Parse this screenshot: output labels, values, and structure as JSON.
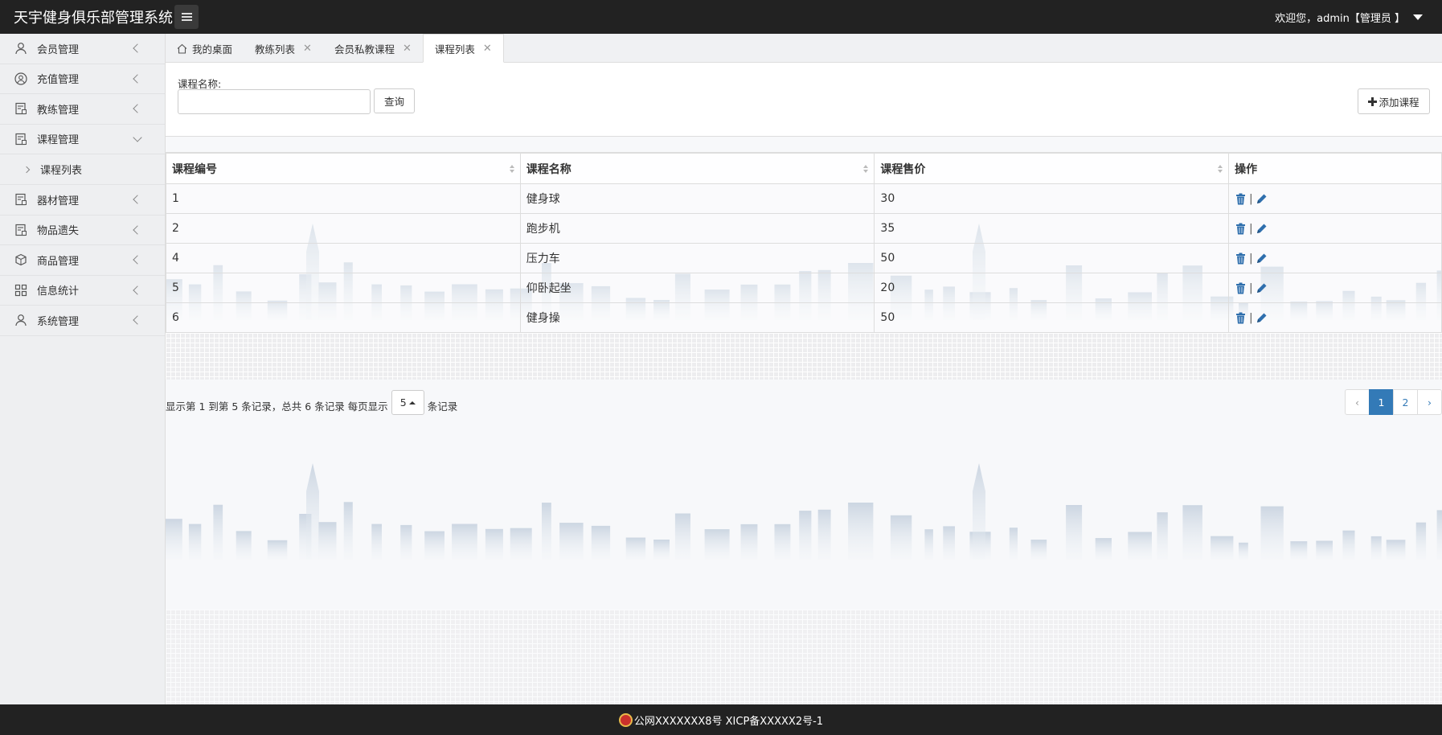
{
  "header": {
    "title": "天宇健身俱乐部管理系统",
    "welcome": "欢迎您，admin【管理员 】"
  },
  "sidebar": {
    "items": [
      {
        "label": "会员管理",
        "icon": "user-icon"
      },
      {
        "label": "充值管理",
        "icon": "user-circle-icon"
      },
      {
        "label": "教练管理",
        "icon": "calendar-icon"
      },
      {
        "label": "课程管理",
        "icon": "calendar-icon",
        "expanded": true,
        "children": [
          {
            "label": "课程列表"
          }
        ]
      },
      {
        "label": "器材管理",
        "icon": "calendar-icon"
      },
      {
        "label": "物品遗失",
        "icon": "calendar-icon"
      },
      {
        "label": "商品管理",
        "icon": "box-icon"
      },
      {
        "label": "信息统计",
        "icon": "grid-icon"
      },
      {
        "label": "系统管理",
        "icon": "user-icon"
      }
    ]
  },
  "tabs": [
    {
      "label": "我的桌面",
      "closable": false
    },
    {
      "label": "教练列表",
      "closable": true
    },
    {
      "label": "会员私教课程",
      "closable": true
    },
    {
      "label": "课程列表",
      "closable": true,
      "active": true
    }
  ],
  "search": {
    "label": "课程名称:",
    "value": "",
    "placeholder": "",
    "query_button": "查询",
    "add_button": "添加课程"
  },
  "table": {
    "columns": [
      "课程编号",
      "课程名称",
      "课程售价",
      "操作"
    ],
    "rows": [
      {
        "id": "1",
        "name": "健身球",
        "price": "30"
      },
      {
        "id": "2",
        "name": "跑步机",
        "price": "35"
      },
      {
        "id": "4",
        "name": "压力车",
        "price": "50"
      },
      {
        "id": "5",
        "name": "仰卧起坐",
        "price": "20"
      },
      {
        "id": "6",
        "name": "健身操",
        "price": "50"
      }
    ],
    "op_separator": "|"
  },
  "pagination": {
    "info_prefix": "显示第 1 到第 5 条记录，总共 6 条记录 每页显示",
    "page_size": "5",
    "info_suffix": "条记录",
    "prev": "‹",
    "pages": [
      "1",
      "2"
    ],
    "current": "1",
    "next": "›"
  },
  "footer": {
    "text": "公网XXXXXXX8号 XICP备XXXXX2号-1"
  },
  "colors": {
    "topbar": "#222222",
    "accent": "#337ab7",
    "icon_blue": "#2f6fad"
  }
}
